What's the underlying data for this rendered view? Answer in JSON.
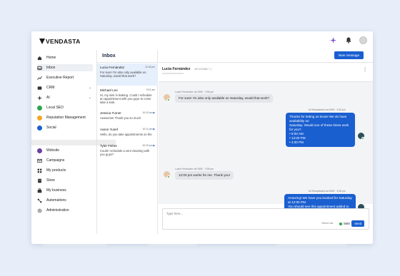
{
  "brand": {
    "logo_text": "VENDASTA"
  },
  "topbar": {
    "icons": [
      "sparkle-icon",
      "bell-icon",
      "avatar"
    ]
  },
  "sidebar": {
    "items": [
      {
        "label": "Home",
        "icon": "home-icon"
      },
      {
        "label": "Inbox",
        "icon": "inbox-icon",
        "active": true
      },
      {
        "label": "Executive Report",
        "icon": "chart-icon"
      },
      {
        "label": "CRM",
        "icon": "crm-icon",
        "expandable": true
      },
      {
        "label": "AI",
        "icon": "ai-icon",
        "expandable": true
      },
      {
        "label": "Local SEO",
        "icon": "local-seo-icon"
      },
      {
        "label": "Reputation Management",
        "icon": "reputation-icon"
      },
      {
        "label": "Social",
        "icon": "social-icon"
      },
      {
        "label": "Website",
        "icon": "website-icon"
      },
      {
        "label": "Campaigns",
        "icon": "campaigns-icon"
      },
      {
        "label": "My products",
        "icon": "products-icon"
      },
      {
        "label": "Store",
        "icon": "store-icon"
      },
      {
        "label": "My business",
        "icon": "business-icon"
      },
      {
        "label": "Automations",
        "icon": "automations-icon"
      },
      {
        "label": "Administration",
        "icon": "admin-icon"
      }
    ]
  },
  "inbox": {
    "title": "Inbox",
    "new_message_label": "New message",
    "conversations": [
      {
        "name": "Lucia Fernández",
        "time": "11:06 pm",
        "preview": "For sure! I'm also only available on Saturday, would that work?"
      },
      {
        "name": "Michael Lee",
        "time": "9:31 am",
        "preview": "Hi, my sink is leaking. Could I schedule an appointment with you guys to come take a look."
      },
      {
        "name": "Jessica Turner",
        "time": "10:15 pm",
        "preview": "Awesome! Thank you so much"
      },
      {
        "name": "Aaron Yusef",
        "time": "10:12 pm",
        "preview": "Hello, do you take appointments on the"
      },
      {
        "name": "Tyler Fisher",
        "time": "10:15 pm",
        "preview": "Could I schedule a vent cleaning with you guys?"
      }
    ]
  },
  "chat": {
    "contact_name": "Lucia Fernández",
    "contact_id": "4071234567",
    "messages": [
      {
        "direction": "in",
        "meta": "Lucia Fernández via SMS · 3:35 pm",
        "text": "For sure! I'm also only available on Saturday, would that work?"
      },
      {
        "direction": "out",
        "meta": "AI Receptionist via SMS · 3:35 pm",
        "lines": [
          "Thanks for letting us know! We do have availability on",
          "Saturday. Would one of these times work for you?",
          "•  9:00 AM",
          "•  12:00 PM",
          "•  4:00 PM"
        ]
      },
      {
        "direction": "in",
        "meta": "Lucia Fernández via SMS · 3:35 pm",
        "text": "12:00 pm works for me. Thank you!"
      },
      {
        "direction": "out",
        "meta": "AI Receptionist via SMS · 3:35 pm",
        "lines": [
          "Amazing! We have you booked for Saturday at 12:00 PM.",
          "You should see this appointment added to your calendar",
          "shortly."
        ]
      }
    ],
    "composer": {
      "placeholder": "Type here...",
      "send_via_label": "Send via",
      "channel": "SMS",
      "send_label": "Send"
    }
  }
}
